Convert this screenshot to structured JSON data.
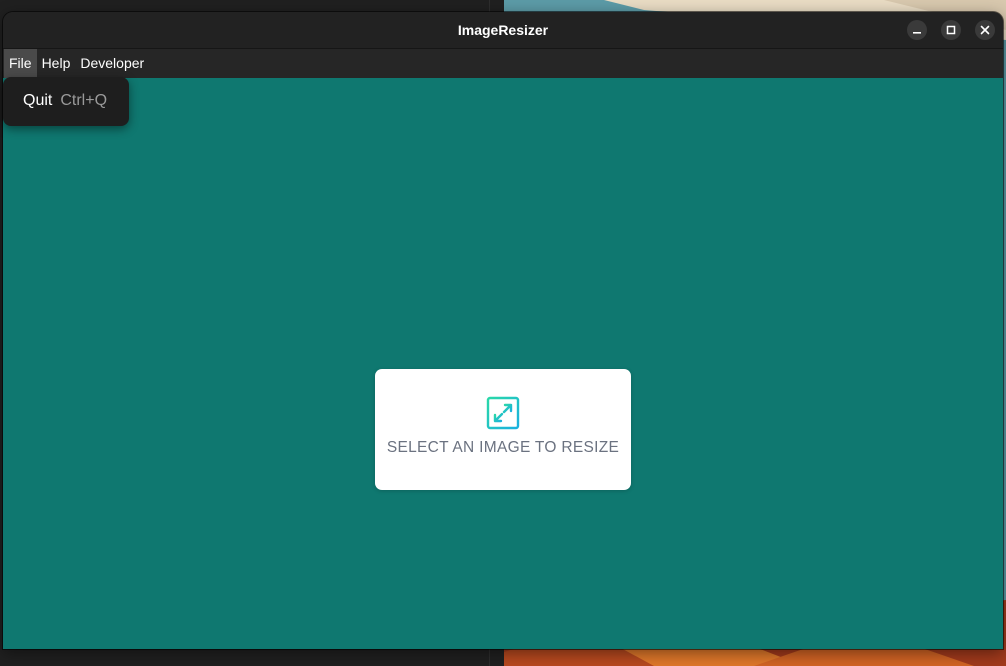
{
  "window": {
    "title": "ImageResizer"
  },
  "menubar": {
    "items": [
      {
        "label": "File"
      },
      {
        "label": "Help"
      },
      {
        "label": "Developer"
      }
    ]
  },
  "file_menu": {
    "items": [
      {
        "label": "Quit",
        "shortcut": "Ctrl+Q"
      }
    ]
  },
  "main": {
    "prompt": "SELECT AN IMAGE TO RESIZE",
    "icon": "expand-arrows-icon"
  },
  "colors": {
    "content_background": "#0f7870",
    "titlebar": "#222222",
    "icon_gradient_start": "#2ad8a8",
    "icon_gradient_end": "#1ab0e0"
  }
}
